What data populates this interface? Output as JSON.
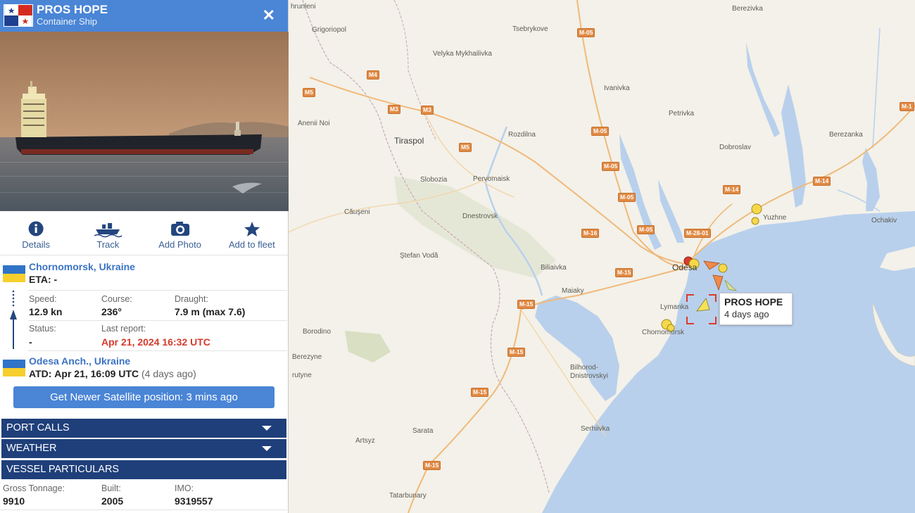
{
  "panel": {
    "vessel_name": "PROS HOPE",
    "vessel_type": "Container Ship",
    "flag": "panama-flag",
    "close_icon": "close-icon",
    "actions": [
      {
        "label": "Details",
        "icon": "info-circle-icon"
      },
      {
        "label": "Track",
        "icon": "ship-icon"
      },
      {
        "label": "Add Photo",
        "icon": "camera-icon"
      },
      {
        "label": "Add to fleet",
        "icon": "star-icon"
      }
    ],
    "destination": {
      "port": "Chornomorsk, Ukraine",
      "eta_label": "ETA:",
      "eta_value": "-",
      "flag": "ukraine-flag"
    },
    "origin": {
      "port": "Odesa Anch., Ukraine",
      "atd_label": "ATD:",
      "atd_value": "Apr 21, 16:09 UTC",
      "atd_relative": "(4 days ago)",
      "flag": "ukraine-flag"
    },
    "stats": {
      "speed_label": "Speed:",
      "speed_value": "12.9 kn",
      "course_label": "Course:",
      "course_value": "236°",
      "draught_label": "Draught:",
      "draught_value": "7.9 m (max 7.6)",
      "status_label": "Status:",
      "status_value": "-",
      "last_report_label": "Last report:",
      "last_report_value": "Apr 21, 2024 16:32 UTC"
    },
    "satellite_button": "Get Newer Satellite position: 3 mins ago",
    "sections": [
      {
        "label": "PORT CALLS",
        "expandable": true
      },
      {
        "label": "WEATHER",
        "expandable": true
      },
      {
        "label": "VESSEL PARTICULARS",
        "expandable": false
      }
    ],
    "particulars": {
      "gross_tonnage_label": "Gross Tonnage:",
      "gross_tonnage_value": "9910",
      "built_label": "Built:",
      "built_value": "2005",
      "imo_label": "IMO:",
      "imo_value": "9319557"
    },
    "colors": {
      "header": "#4a85d6",
      "section_bar": "#1f3f7a",
      "link": "#3b73c4",
      "alert": "#d43b2c"
    }
  },
  "map": {
    "places": {
      "hrunleni": "hrunleni",
      "grigoriopol": "Grigoriopol",
      "tsebrykove": "Tsebrykove",
      "berezivka": "Berezivka",
      "velyka": "Velyka Mykhailivka",
      "ivanivka": "Ivanivka",
      "petrivka": "Petrivka",
      "aneni": "Anenii Noi",
      "tiraspol": "Tiraspol",
      "rozdilna": "Rozdilna",
      "dobroslav": "Dobroslav",
      "berezanka": "Berezanka",
      "slobozia": "Slobozia",
      "pervomaisk": "Pervomaisk",
      "causeni": "Căuşeni",
      "dnestrovsk": "Dnestrovsk",
      "yuzhne": "Yuzhne",
      "ochakiv": "Ochakiv",
      "stefan": "Ştefan Vodă",
      "biliaivka": "Biliaivka",
      "odesa": "Odesa",
      "maiaky": "Maiaky",
      "lymanka": "Lymanka",
      "borodino": "Borodino",
      "chornomorsk": "Chornomorsk",
      "berezyne": "Berezyne",
      "bilhorod": "Bilhorod-\nDnistrovskyi",
      "tatarbunary": "Tatarbunary",
      "sarata": "Sarata",
      "artsyz": "Artsyz",
      "serhiivka": "Serhiivka",
      "plutyne": "rutyne"
    },
    "roads": [
      "M-05",
      "M4",
      "M5",
      "M3",
      "M3",
      "M-05",
      "M5",
      "M-05",
      "M-05",
      "M-05",
      "M-14",
      "M-14",
      "M-1",
      "M-28-01",
      "M-16",
      "M-15",
      "M-15",
      "M-15",
      "M-15",
      "M-15",
      "M-15"
    ],
    "tooltip": {
      "name": "PROS HOPE",
      "age": "4 days ago"
    },
    "colors": {
      "land": "#f3f1e9",
      "water": "#b9d0ec",
      "road": "#f0b97a",
      "vessel_marker": "#f5d84a"
    }
  }
}
